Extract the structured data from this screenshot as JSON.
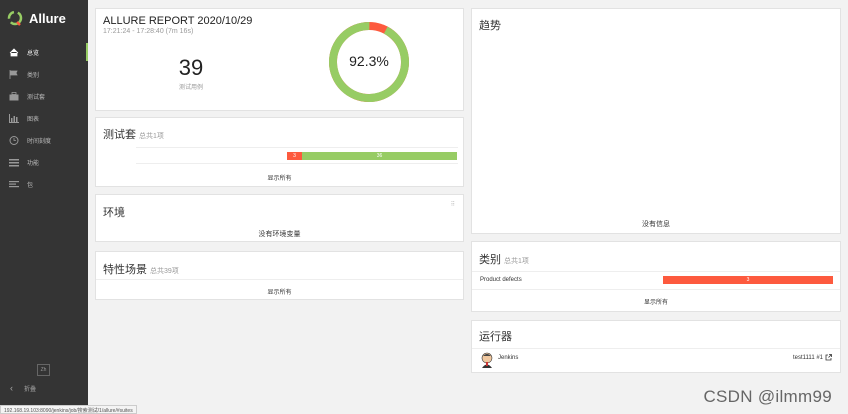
{
  "app": {
    "name": "Allure"
  },
  "sidebar": {
    "items": [
      {
        "label": "总览",
        "icon": "home-icon"
      },
      {
        "label": "类别",
        "icon": "flag-icon"
      },
      {
        "label": "测试套",
        "icon": "briefcase-icon"
      },
      {
        "label": "图表",
        "icon": "bar-chart-icon"
      },
      {
        "label": "时间刻度",
        "icon": "clock-icon"
      },
      {
        "label": "功能",
        "icon": "list-icon"
      },
      {
        "label": "包",
        "icon": "align-left-icon"
      }
    ],
    "language": "Zh",
    "collapse_label": "折叠"
  },
  "summary": {
    "title": "ALLURE REPORT 2020/10/29",
    "time_range": "17:21:24 - 17:28:40 (7m 16s)",
    "test_count": "39",
    "test_count_label": "测试用例",
    "pass_rate": "92.3%",
    "pass_fraction": 0.923,
    "color_pass": "#97cc64",
    "color_fail": "#fd5a3e"
  },
  "suites": {
    "title": "测试套",
    "subtitle": "总共1项",
    "failed": "3",
    "passed": "36",
    "show_all": "显示所有"
  },
  "environment": {
    "title": "环境",
    "empty": "没有环境变量"
  },
  "features": {
    "title": "特性场景",
    "subtitle": "总共39项",
    "show_all": "显示所有"
  },
  "trend": {
    "title": "趋势",
    "empty": "没有信息"
  },
  "categories": {
    "title": "类别",
    "subtitle": "总共1项",
    "item_name": "Product defects",
    "item_count": "3",
    "show_all": "显示所有"
  },
  "executors": {
    "title": "运行器",
    "name": "Jenkins",
    "build": "test1111 #1"
  },
  "statusbar": {
    "url": "192.168.19.103:8090/jenkins/job/搜索测试/1/allure/#suites"
  },
  "watermark": "CSDN @ilmm99"
}
